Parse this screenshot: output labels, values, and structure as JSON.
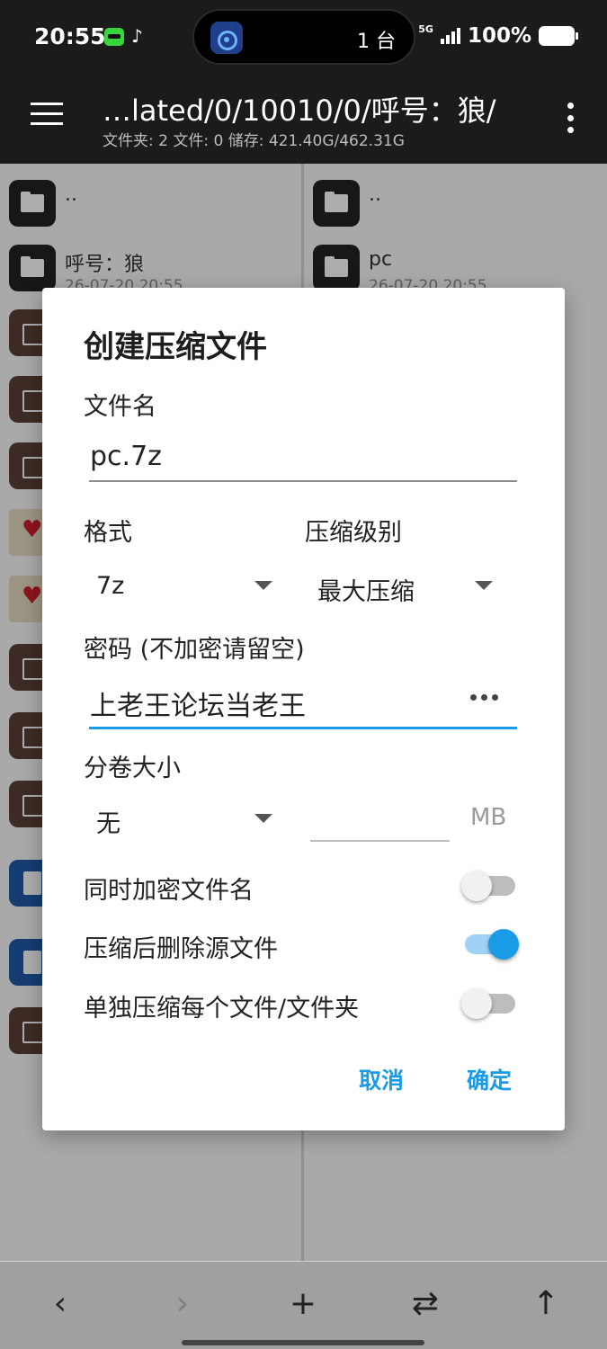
{
  "status_bar": {
    "time": "20:55",
    "app_icon_1": "game-app-icon",
    "app_icon_2": "tiktok-icon",
    "island_icon": "hotspot-icon",
    "island_count": "1 台",
    "network": "5G",
    "battery_percent": "100%",
    "battery_level": 1.0
  },
  "app_bar": {
    "path": "…lated/0/10010/0/呼号：狼/",
    "info": "文件夹: 2  文件: 0  储存: 421.40G/462.31G"
  },
  "left_pane": {
    "items": [
      {
        "name": "..",
        "date": "",
        "icon": "folder-icon"
      },
      {
        "name": "呼号：狼",
        "date": "26-07-20 20:55",
        "icon": "folder-icon"
      }
    ]
  },
  "right_pane": {
    "items": [
      {
        "name": "..",
        "date": "",
        "icon": "folder-icon"
      },
      {
        "name": "pc",
        "date": "26-07-20 20:55",
        "icon": "folder-icon"
      }
    ]
  },
  "dialog": {
    "title": "创建压缩文件",
    "filename_label": "文件名",
    "filename_value": "pc.7z",
    "format_label": "格式",
    "format_value": "7z",
    "level_label": "压缩级别",
    "level_value": "最大压缩",
    "password_label": "密码 (不加密请留空)",
    "password_value": "上老王论坛当老王",
    "volume_label": "分卷大小",
    "volume_value": "无",
    "volume_unit": "MB",
    "switches": [
      {
        "label": "同时加密文件名",
        "on": false
      },
      {
        "label": "压缩后删除源文件",
        "on": true
      },
      {
        "label": "单独压缩每个文件/文件夹",
        "on": false
      }
    ],
    "cancel_label": "取消",
    "ok_label": "确定"
  },
  "bottom_bar": {
    "back": "‹",
    "forward": "›",
    "add": "+",
    "swap": "⇄",
    "up": "↑"
  },
  "colors": {
    "accent": "#1a9be6",
    "bar_background": "#1b1b1b",
    "archive_icon": "#5d4037",
    "document_icon": "#1f5ba8"
  }
}
